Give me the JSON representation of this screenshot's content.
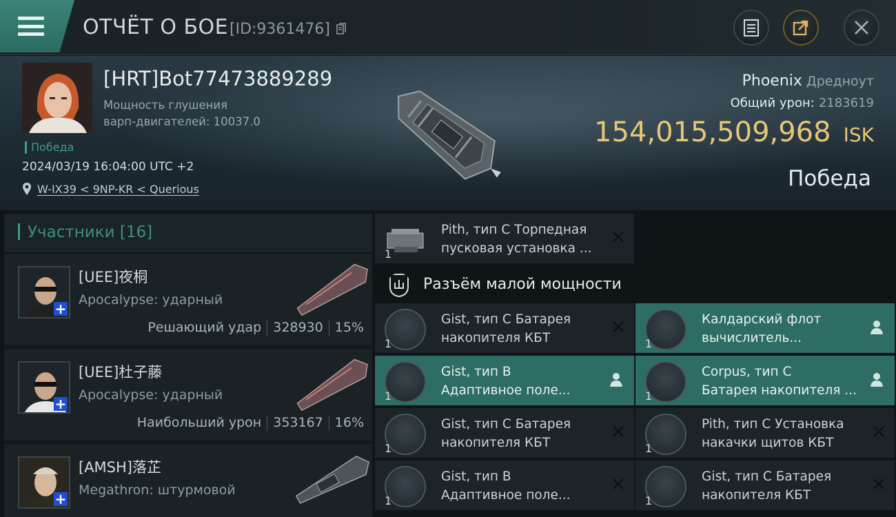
{
  "header": {
    "title": "ОТЧЁТ О БОЕ",
    "report_id": "[ID:9361476]",
    "icons": [
      "menu-icon",
      "copy-icon",
      "clipboard-icon",
      "share-icon",
      "close-icon"
    ]
  },
  "victim": {
    "name": "[HRT]Bot77473889289",
    "stat_line1": "Мощность глушения",
    "stat_line2": "варп-двигателей: 10037.0",
    "status": "Победа",
    "datetime": "2024/03/19 16:04:00 UTC +2",
    "location": "W-IX39 < 9NP-KR < Querious",
    "ship_name": "Phoenix",
    "ship_class": "Дредноут",
    "total_damage_label": "Общий урон:",
    "total_damage": "2183619",
    "isk_value": "154,015,509,968",
    "isk_unit": "ISK",
    "result": "Победа"
  },
  "participants": {
    "header": "Участники [16]",
    "rows": [
      {
        "name": "[UEE]夜桐",
        "ship": "Apocalypse: ударный",
        "role": "Решающий удар",
        "damage": "328930",
        "percent": "15%"
      },
      {
        "name": "[UEE]杜子藤",
        "ship": "Apocalypse: ударный",
        "role": "Наибольший урон",
        "damage": "353167",
        "percent": "16%"
      },
      {
        "name": "[AMSH]落芷",
        "ship": "Megathron: штурмовой",
        "role": "",
        "damage": "",
        "percent": ""
      }
    ]
  },
  "modules": {
    "top": {
      "qty": "1",
      "line1": "Pith, тип C Торпедная",
      "line2": "пусковая установка ..."
    },
    "slot_title": "Разъём малой мощности",
    "items": [
      {
        "qty": "1",
        "line1": "Gist, тип C Батарея",
        "line2": "накопителя КБТ",
        "action": "close"
      },
      {
        "qty": "1",
        "line1": "Калдарский флот",
        "line2": "вычислитель...",
        "action": "person"
      },
      {
        "qty": "1",
        "line1": "Gist, тип B",
        "line2": "Адаптивное поле...",
        "action": "person"
      },
      {
        "qty": "1",
        "line1": "Corpus, тип C",
        "line2": "Батарея накопителя ...",
        "action": "person"
      },
      {
        "qty": "1",
        "line1": "Gist, тип C Батарея",
        "line2": "накопителя КБТ",
        "action": "close"
      },
      {
        "qty": "1",
        "line1": "Pith, тип C Установка",
        "line2": "накачки щитов КБТ",
        "action": "close"
      },
      {
        "qty": "1",
        "line1": "Gist, тип B",
        "line2": "Адаптивное поле...",
        "action": "close"
      },
      {
        "qty": "1",
        "line1": "Gist, тип C Батарея",
        "line2": "накопителя КБТ",
        "action": "close"
      }
    ]
  },
  "colors": {
    "accent": "#3f9b86",
    "isk": "#e7c776",
    "highlight_row": "#2e6d63"
  }
}
